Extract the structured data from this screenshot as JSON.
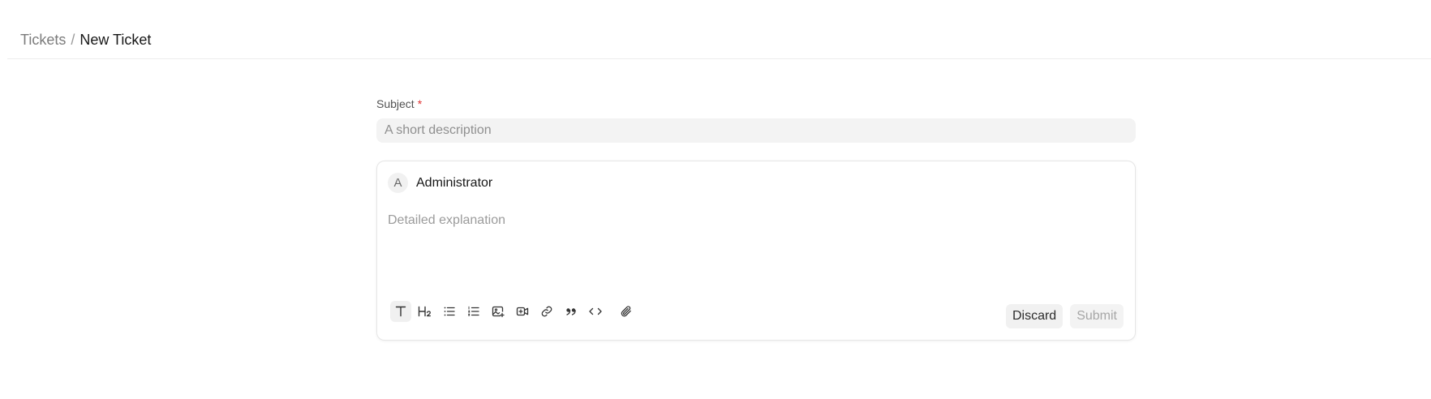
{
  "breadcrumb": {
    "items": [
      {
        "label": "Tickets"
      },
      {
        "label": "New Ticket"
      }
    ],
    "separator": "/"
  },
  "form": {
    "subject": {
      "label": "Subject",
      "required_mark": "*",
      "value": "",
      "placeholder": "A short description"
    },
    "editor": {
      "author": {
        "avatar_initial": "A",
        "name": "Administrator"
      },
      "placeholder": "Detailed explanation",
      "toolbar": [
        {
          "name": "text-style-icon",
          "active": true
        },
        {
          "name": "heading-2-icon",
          "active": false
        },
        {
          "name": "bullet-list-icon",
          "active": false
        },
        {
          "name": "numbered-list-icon",
          "active": false
        },
        {
          "name": "image-icon",
          "active": false
        },
        {
          "name": "video-icon",
          "active": false
        },
        {
          "name": "link-icon",
          "active": false
        },
        {
          "name": "blockquote-icon",
          "active": false
        },
        {
          "name": "code-icon",
          "active": false
        },
        {
          "name": "attachment-icon",
          "active": false
        }
      ],
      "actions": {
        "discard_label": "Discard",
        "submit_label": "Submit"
      }
    }
  },
  "colors": {
    "required": "#e03131",
    "input_background": "#f3f3f3",
    "muted_text": "#7c7c7c"
  }
}
